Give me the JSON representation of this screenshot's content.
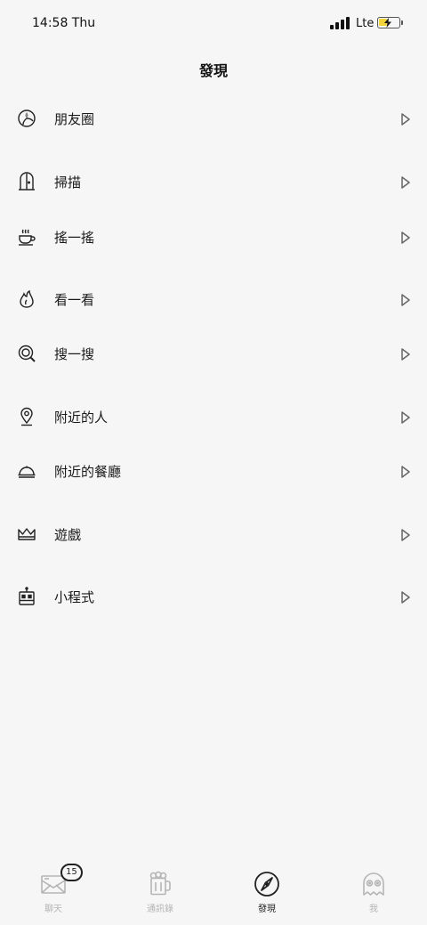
{
  "status_bar": {
    "time": "14:58 Thu",
    "network": "Lte"
  },
  "page": {
    "title": "發現"
  },
  "menu": [
    {
      "label": "朋友圈",
      "icon": "moments-icon"
    },
    {
      "label": "掃描",
      "icon": "door-icon"
    },
    {
      "label": "搖一搖",
      "icon": "coffee-cup-icon"
    },
    {
      "label": "看一看",
      "icon": "flame-icon"
    },
    {
      "label": "搜一搜",
      "icon": "search-icon"
    },
    {
      "label": "附近的人",
      "icon": "location-pin-icon"
    },
    {
      "label": "附近的餐廳",
      "icon": "cloche-icon"
    },
    {
      "label": "遊戲",
      "icon": "crown-icon"
    },
    {
      "label": "小程式",
      "icon": "robot-icon"
    }
  ],
  "tab_bar": {
    "tabs": [
      {
        "label": "聊天",
        "icon": "envelope-icon",
        "badge": "15"
      },
      {
        "label": "通訊錄",
        "icon": "beer-mug-icon"
      },
      {
        "label": "發現",
        "icon": "compass-icon",
        "active": true
      },
      {
        "label": "我",
        "icon": "ghost-icon"
      }
    ]
  }
}
